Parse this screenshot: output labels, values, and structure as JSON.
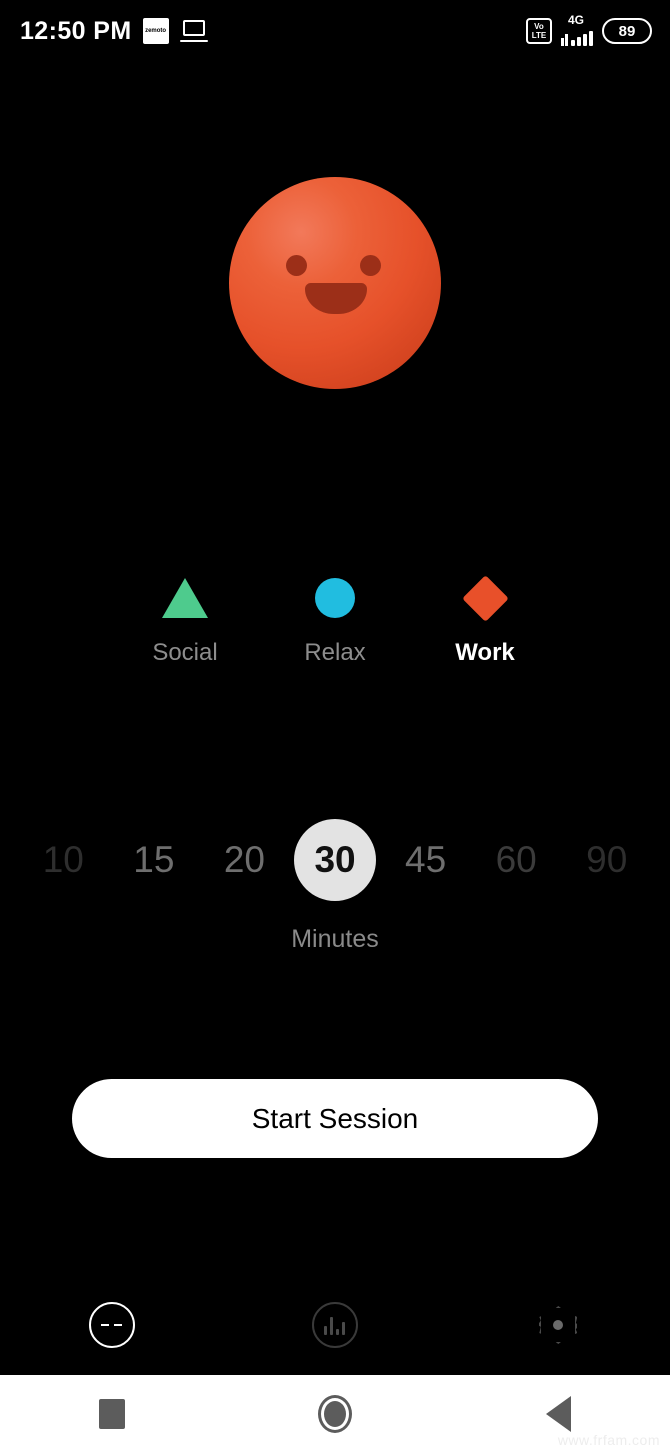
{
  "status_bar": {
    "time": "12:50 PM",
    "app_icon_label": "zemoto",
    "icons": [
      "app-badge-icon",
      "laptop-icon",
      "volte-icon",
      "signal-4g-icon",
      "battery-icon"
    ],
    "volte_top": "Vo",
    "volte_bottom": "LTE",
    "network": "4G",
    "battery_percent": "89"
  },
  "avatar": {
    "name": "focus-orb-emoji",
    "expression": "smiling",
    "color": "#e6512a",
    "feature_color": "#9c2f18"
  },
  "categories": {
    "selected": "Work",
    "items": [
      {
        "label": "Social",
        "shape": "triangle",
        "color": "#4ecb8d",
        "selected": false
      },
      {
        "label": "Relax",
        "shape": "circle",
        "color": "#21bde0",
        "selected": false
      },
      {
        "label": "Work",
        "shape": "diamond",
        "color": "#e8502a",
        "selected": true
      }
    ]
  },
  "duration": {
    "options": [
      "10",
      "15",
      "20",
      "30",
      "45",
      "60",
      "90"
    ],
    "selected": "30",
    "unit_label": "Minutes"
  },
  "primary_action": {
    "label": "Start Session"
  },
  "tab_bar": {
    "active": "timer",
    "items": [
      {
        "name": "timer",
        "icon": "face-timer-icon",
        "active": true
      },
      {
        "name": "stats",
        "icon": "bar-chart-icon",
        "active": false
      },
      {
        "name": "settings",
        "icon": "gear-icon",
        "active": false
      }
    ]
  },
  "nav_bar": {
    "items": [
      {
        "name": "recents",
        "icon": "square-icon"
      },
      {
        "name": "home",
        "icon": "circle-icon"
      },
      {
        "name": "back",
        "icon": "triangle-back-icon"
      }
    ]
  },
  "watermark": "www.frfam.com"
}
